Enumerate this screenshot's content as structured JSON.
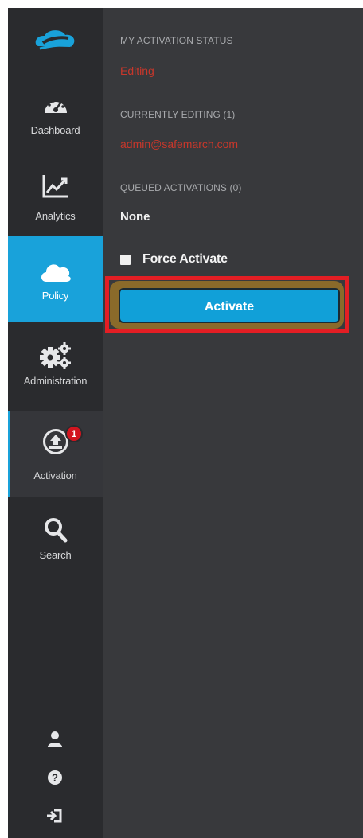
{
  "sidebar": {
    "logo_icon": "cloud-logo-icon",
    "items": [
      {
        "label": "Dashboard",
        "icon": "gauge-icon"
      },
      {
        "label": "Analytics",
        "icon": "line-chart-icon"
      },
      {
        "label": "Policy",
        "icon": "cloud-icon"
      },
      {
        "label": "Administration",
        "icon": "gears-icon"
      },
      {
        "label": "Activation",
        "icon": "upload-icon",
        "badge": "1"
      },
      {
        "label": "Search",
        "icon": "search-icon"
      }
    ],
    "bottom_icons": [
      "user-icon",
      "help-icon",
      "logout-icon"
    ]
  },
  "panel": {
    "my_status_label": "MY ACTIVATION STATUS",
    "my_status_value": "Editing",
    "editing_label": "CURRENTLY EDITING (1)",
    "editing_user": "admin@safemarch.com",
    "queued_label": "QUEUED ACTIVATIONS (0)",
    "queued_value": "None",
    "force_activate_label": "Force Activate",
    "activate_button": "Activate"
  },
  "colors": {
    "sidebar_bg": "#2a2b2e",
    "panel_bg": "#38393c",
    "accent": "#19a2da",
    "status_red": "#c8372b",
    "highlight": "#e31e24"
  }
}
